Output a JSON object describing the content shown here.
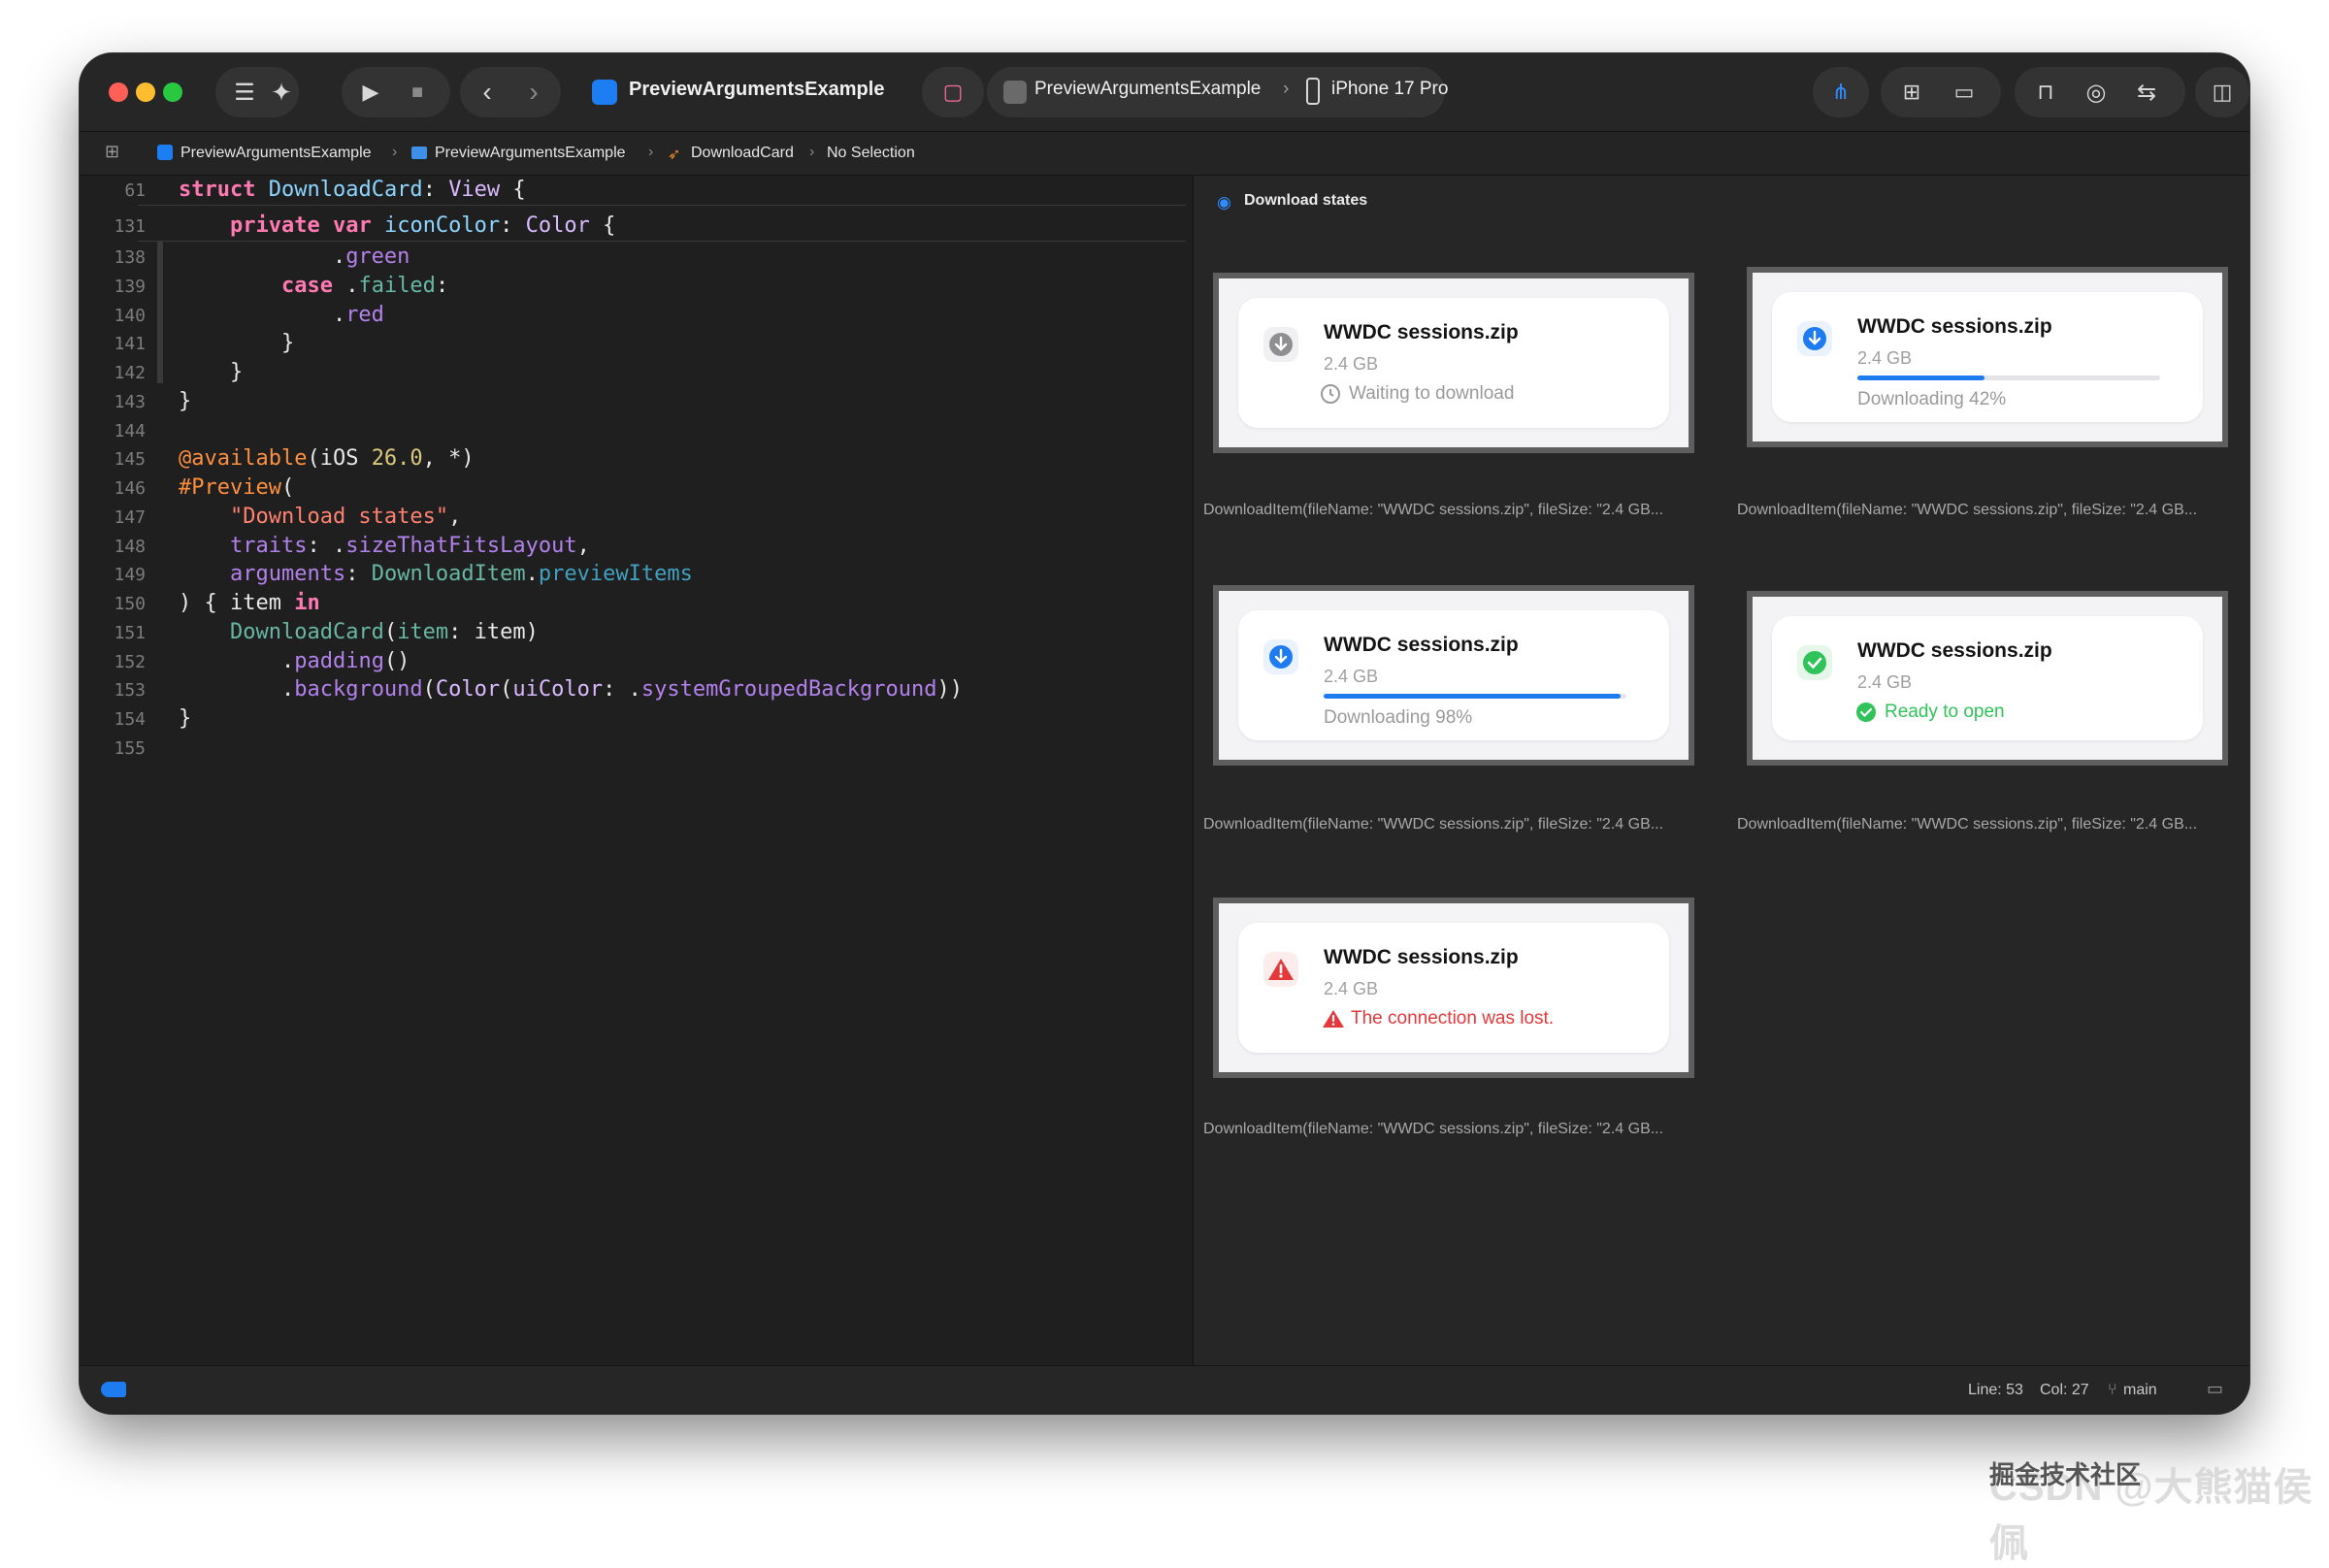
{
  "toolbar": {
    "project_name": "PreviewArgumentsExample",
    "scheme_name": "PreviewArgumentsExample",
    "device_name": "iPhone 17 Pro"
  },
  "jumpbar": {
    "crumbs": [
      "PreviewArgumentsExample",
      "PreviewArgumentsExample",
      "DownloadCard",
      "No Selection"
    ]
  },
  "editor": {
    "line_numbers": [
      "61",
      "131",
      "138",
      "139",
      "140",
      "141",
      "142",
      "143",
      "144",
      "145",
      "146",
      "147",
      "148",
      "149",
      "150",
      "151",
      "152",
      "153",
      "154",
      "155"
    ]
  },
  "preview": {
    "title": "Download states",
    "items": [
      {
        "name": "WWDC sessions.zip",
        "size": "2.4 GB",
        "status": "Waiting to download",
        "state": "waiting",
        "caption": "DownloadItem(fileName: \"WWDC sessions.zip\", fileSize: \"2.4 GB..."
      },
      {
        "name": "WWDC sessions.zip",
        "size": "2.4 GB",
        "status": "Downloading 42%",
        "state": "downloading",
        "progress": 0.42,
        "caption": "DownloadItem(fileName: \"WWDC sessions.zip\", fileSize: \"2.4 GB..."
      },
      {
        "name": "WWDC sessions.zip",
        "size": "2.4 GB",
        "status": "Downloading 98%",
        "state": "downloading",
        "progress": 0.98,
        "caption": "DownloadItem(fileName: \"WWDC sessions.zip\", fileSize: \"2.4 GB..."
      },
      {
        "name": "WWDC sessions.zip",
        "size": "2.4 GB",
        "status": "Ready to open",
        "state": "ready",
        "caption": "DownloadItem(fileName: \"WWDC sessions.zip\", fileSize: \"2.4 GB..."
      },
      {
        "name": "WWDC sessions.zip",
        "size": "2.4 GB",
        "status": "The connection was lost.",
        "state": "failed",
        "caption": "DownloadItem(fileName: \"WWDC sessions.zip\", fileSize: \"2.4 GB..."
      }
    ]
  },
  "statusbar": {
    "line": "Line: 53",
    "col": "Col: 27",
    "branch": "main"
  },
  "colors": {
    "accent": "#1e7cf0",
    "ready": "#30c35a",
    "failed": "#e5383b",
    "waiting": "#8e8e93"
  },
  "watermark": "CSDN @大熊猫侯佩",
  "watermark_overlay": "掘金技术社区"
}
